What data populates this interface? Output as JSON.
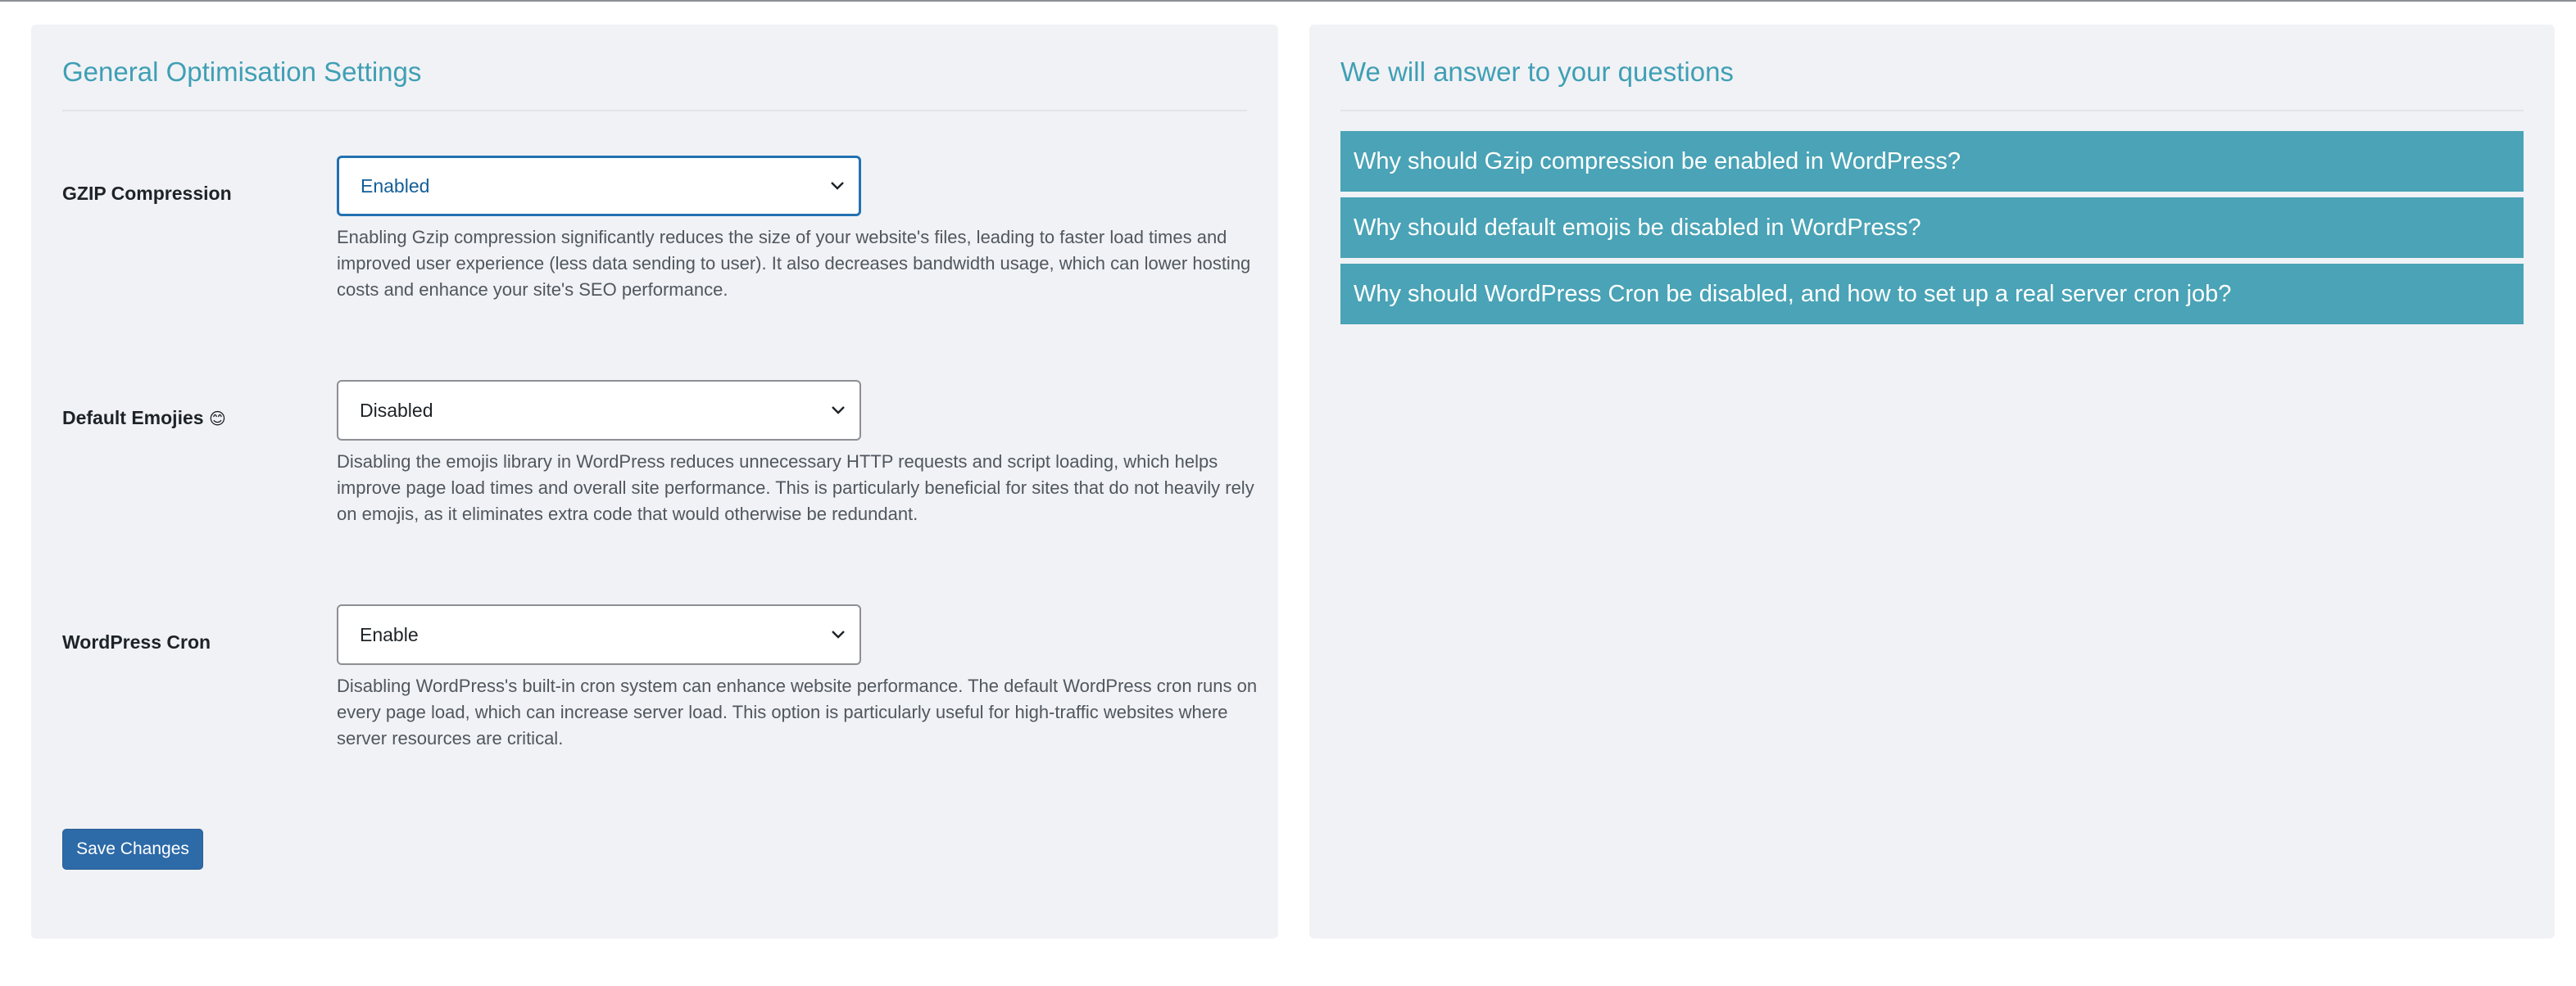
{
  "settings_panel": {
    "title": "General Optimisation Settings",
    "settings": [
      {
        "label": "GZIP Compression",
        "selected": "Enabled",
        "description": "Enabling Gzip compression significantly reduces the size of your website's files, leading to faster load times and improved user experience (less data sending to user). It also decreases bandwidth usage, which can lower hosting costs and enhance your site's SEO performance."
      },
      {
        "label": "Default Emojies",
        "label_emoji": "😊",
        "selected": "Disabled",
        "description": "Disabling the emojis library in WordPress reduces unnecessary HTTP requests and script loading, which helps improve page load times and overall site performance. This is particularly beneficial for sites that do not heavily rely on emojis, as it eliminates extra code that would otherwise be redundant."
      },
      {
        "label": "WordPress Cron",
        "selected": "Enable",
        "description": "Disabling WordPress's built-in cron system can enhance website performance. The default WordPress cron runs on every page load, which can increase server load. This option is particularly useful for high-traffic websites where server resources are critical."
      }
    ],
    "save_label": "Save Changes"
  },
  "faq_panel": {
    "title": "We will answer to your questions",
    "items": [
      "Why should Gzip compression be enabled in WordPress?",
      "Why should default emojis be disabled in WordPress?",
      "Why should WordPress Cron be disabled, and how to set up a real server cron job?"
    ]
  },
  "icons": {
    "select_arrow": "chevron-down-icon"
  },
  "colors": {
    "accent": "#3f9fb5",
    "faq_background": "#4aa3b6",
    "button": "#2d6aa8",
    "focus_border": "#2271b1",
    "panel_background": "#f1f2f5"
  }
}
